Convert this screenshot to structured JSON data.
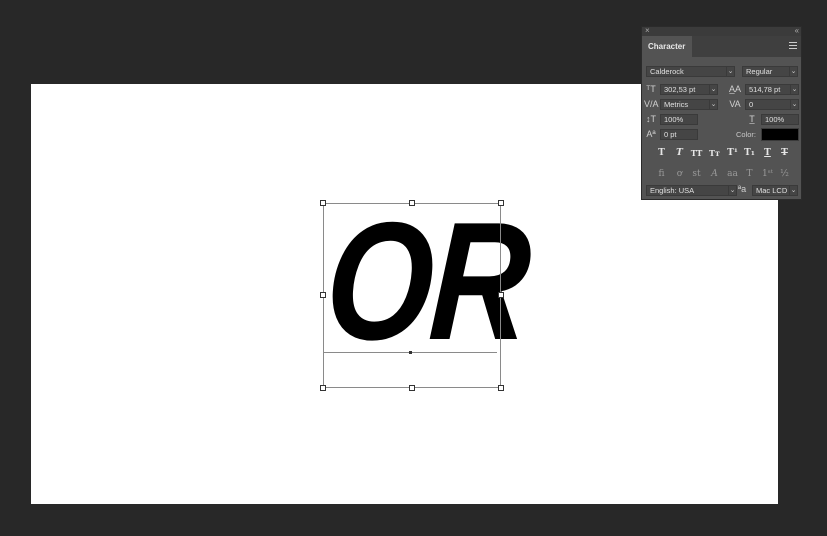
{
  "document": {
    "text_layer": "OR"
  },
  "character_panel": {
    "tab_label": "Character",
    "font_family": "Calderock",
    "font_style": "Regular",
    "font_size": "302,53 pt",
    "leading": "514,78 pt",
    "kerning": "Metrics",
    "tracking": "0",
    "vertical_scale": "100%",
    "horizontal_scale": "100%",
    "baseline_shift": "0 pt",
    "color_label": "Color:",
    "color_value": "#000000",
    "language": "English: USA",
    "antialias": "Mac LCD",
    "icons": {
      "close": "close-icon",
      "collapse": "collapse-icon",
      "menu": "menu-icon"
    }
  }
}
